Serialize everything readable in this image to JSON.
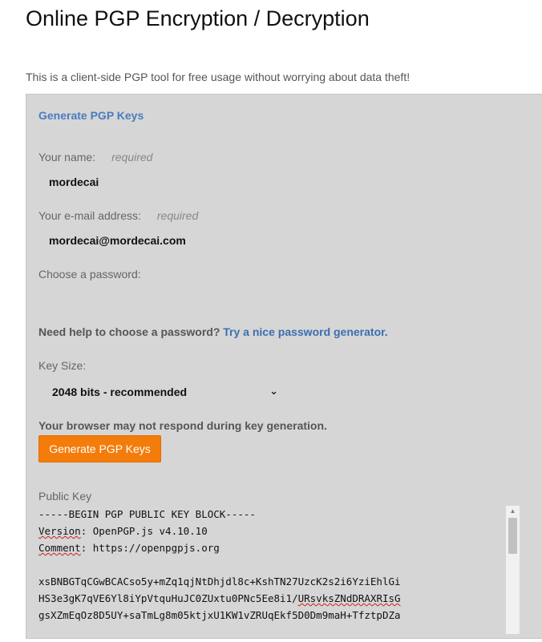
{
  "page": {
    "title": "Online PGP Encryption / Decryption",
    "intro": "This is a client-side PGP tool for free usage without worrying about data theft!"
  },
  "generator": {
    "section_title": "Generate PGP Keys",
    "name_label": "Your name:",
    "name_required": "required",
    "name_value": "mordecai",
    "email_label": "Your e-mail address:",
    "email_required": "required",
    "email_value": "mordecai@mordecai.com",
    "password_label": "Choose a password:",
    "password_value": "",
    "help_text": "Need help to choose a password?",
    "help_link": "Try a nice password generator.",
    "key_size_label": "Key Size:",
    "key_size_selected": "2048 bits - recommended",
    "warning": "Your browser may not respond during key generation.",
    "generate_button": "Generate PGP Keys",
    "public_key_label": "Public Key",
    "public_key_lines": {
      "l0": "-----BEGIN PGP PUBLIC KEY BLOCK-----",
      "l1_key": "Version",
      "l1_rest": ": OpenPGP.js v4.10.10",
      "l2_key": "Comment",
      "l2_rest": ": https://openpgpjs.org",
      "l3": "",
      "l4": "xsBNBGTqCGwBCACso5y+mZq1qjNtDhjdl8c+KshTN27UzcK2s2i6YziEhlGi",
      "l5_a": "HS3e3gK7qVE6Yl8iYpVtquHuJC0ZUxtu0PNc5Ee8i1/",
      "l5_b": "URsvksZNdDRAXRIsG",
      "l6": "gsXZmEqOz8D5UY+saTmLg8m05ktjxU1KW1vZRUqEkf5D0Dm9maH+TfztpDZa"
    }
  },
  "colors": {
    "link": "#3a6fb0",
    "section_title": "#4a7bbf",
    "button": "#f47c0b",
    "panel": "#d6d6d6"
  }
}
